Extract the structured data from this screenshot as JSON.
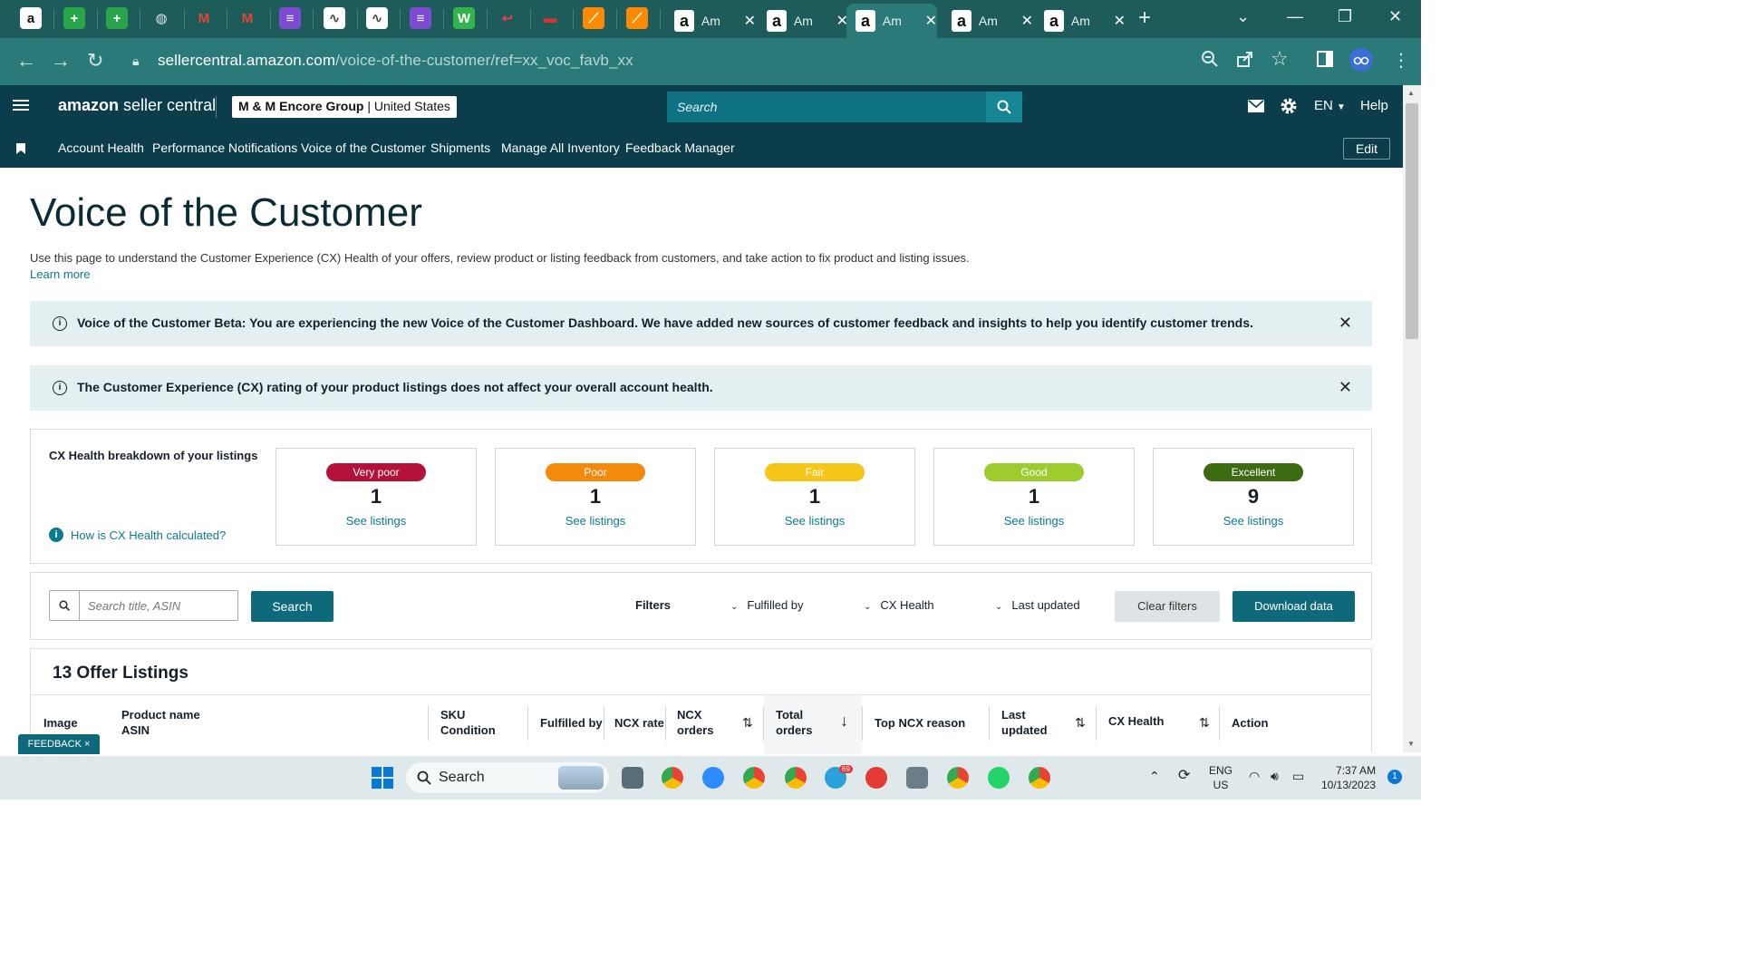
{
  "browser": {
    "tabs_compact": [
      {
        "icon": "amazon-icon",
        "glyph": "a",
        "color": "#ffffff",
        "fg": "#111111"
      },
      {
        "icon": "sheets-plus-icon",
        "glyph": "+",
        "color": "#2aa64a",
        "fg": "#ffffff"
      },
      {
        "icon": "sheets-plus-icon",
        "glyph": "+",
        "color": "#2aa64a",
        "fg": "#ffffff"
      },
      {
        "icon": "globe-icon",
        "glyph": "◍",
        "color": "#1e5c5c",
        "fg": "#d8e6e6"
      },
      {
        "icon": "gmail-icon",
        "glyph": "M",
        "color": "#1e5c5c",
        "fg": "#ea4335"
      },
      {
        "icon": "gmail-icon",
        "glyph": "M",
        "color": "#1e5c5c",
        "fg": "#ea4335"
      },
      {
        "icon": "list-icon",
        "glyph": "≡",
        "color": "#7b4bd1",
        "fg": "#ffffff"
      },
      {
        "icon": "chart-doc-icon",
        "glyph": "∿",
        "color": "#ffffff",
        "fg": "#444444"
      },
      {
        "icon": "chart-doc-icon",
        "glyph": "∿",
        "color": "#ffffff",
        "fg": "#444444"
      },
      {
        "icon": "list-icon",
        "glyph": "≡",
        "color": "#7b4bd1",
        "fg": "#ffffff"
      },
      {
        "icon": "w-icon",
        "glyph": "W",
        "color": "#2fb54b",
        "fg": "#ffffff"
      },
      {
        "icon": "arrow-icon",
        "glyph": "↩",
        "color": "#1e5c5c",
        "fg": "#ff3b3b"
      },
      {
        "icon": "flag-icon",
        "glyph": "▬",
        "color": "#1e5c5c",
        "fg": "#e0322c"
      },
      {
        "icon": "pen-icon",
        "glyph": "⟋",
        "color": "#ff8a00",
        "fg": "#ffffff"
      },
      {
        "icon": "pen-icon",
        "glyph": "⟋",
        "color": "#ff8a00",
        "fg": "#ffffff"
      }
    ],
    "tabs_long": [
      {
        "title": "Am",
        "active": false
      },
      {
        "title": "Am",
        "active": false
      },
      {
        "title": "Am",
        "active": true
      },
      {
        "title": "Am",
        "active": false
      },
      {
        "title": "Am",
        "active": false
      }
    ],
    "url_host": "sellercentral.amazon.com",
    "url_path": "/voice-of-the-customer/ref=xx_voc_favb_xx"
  },
  "header": {
    "logo_amazon": "amazon",
    "logo_rest": " seller central",
    "account_name": "M & M Encore Group",
    "account_region": "United States",
    "search_placeholder": "Search",
    "lang": "EN",
    "help": "Help"
  },
  "nav": {
    "items": [
      "Account Health",
      "Performance Notifications",
      "Voice of the Customer",
      "Shipments",
      "Manage All Inventory",
      "Feedback Manager"
    ],
    "edit": "Edit"
  },
  "page": {
    "title": "Voice of the Customer",
    "intro": "Use this page to understand the Customer Experience (CX) Health of your offers, review product or listing feedback from customers, and take action to fix product and listing issues.",
    "learn_more": "Learn more",
    "banner1": "Voice of the Customer Beta: You are experiencing the new Voice of the Customer Dashboard. We have added new sources of customer feedback and insights to help you identify customer trends.",
    "banner2": "The Customer Experience (CX) rating of your product listings does not affect your overall account health."
  },
  "cx": {
    "title": "CX Health breakdown of your listings",
    "how": "How is CX Health calculated?",
    "cards": [
      {
        "label": "Very poor",
        "count": "1",
        "link": "See listings",
        "color": "#b4123a"
      },
      {
        "label": "Poor",
        "count": "1",
        "link": "See listings",
        "color": "#f48a0c"
      },
      {
        "label": "Fair",
        "count": "1",
        "link": "See listings",
        "color": "#f5c518"
      },
      {
        "label": "Good",
        "count": "1",
        "link": "See listings",
        "color": "#9ccc2e"
      },
      {
        "label": "Excellent",
        "count": "9",
        "link": "See listings",
        "color": "#3d6b12"
      }
    ]
  },
  "filters": {
    "search_placeholder": "Search title, ASIN",
    "search_btn": "Search",
    "label": "Filters",
    "dropdowns": [
      "Fulfilled by",
      "CX Health",
      "Last updated"
    ],
    "clear": "Clear filters",
    "download": "Download data"
  },
  "listings": {
    "title": "13 Offer Listings",
    "columns": {
      "image": "Image",
      "product": "Product name",
      "asin": "ASIN",
      "sku": "SKU",
      "condition": "Condition",
      "fulfilled": "Fulfilled by",
      "ncx_rate": "NCX rate",
      "ncx": "NCX",
      "orders": "orders",
      "total": "Total",
      "top_ncx": "Top NCX reason",
      "last": "Last",
      "updated": "updated",
      "cx_health": "CX Health",
      "action": "Action"
    }
  },
  "feedback_tab": "FEEDBACK ×",
  "taskbar": {
    "search": "Search",
    "lang_line1": "ENG",
    "lang_line2": "US",
    "time": "7:37 AM",
    "date": "10/13/2023",
    "telegram_badge": "69",
    "notif_count": "1"
  }
}
